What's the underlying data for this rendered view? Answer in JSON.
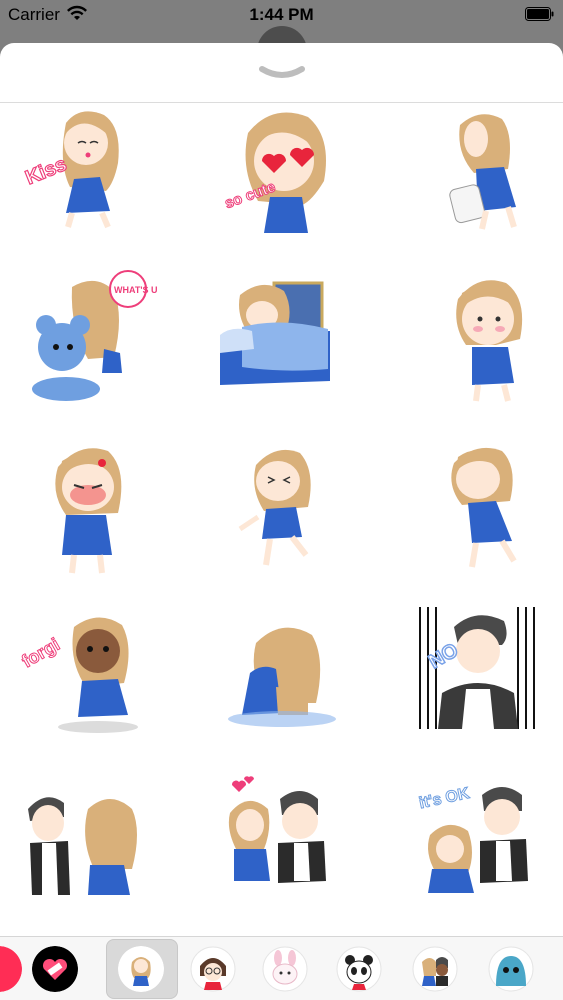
{
  "status_bar": {
    "carrier": "Carrier",
    "time": "1:44 PM"
  },
  "sheet": {
    "collapse_icon": "chevron-down-icon"
  },
  "stickers": [
    {
      "name": "sticker-kiss",
      "caption": "Kiss",
      "colors": {
        "hair": "#d9b07a",
        "dress": "#2f62c8",
        "text": "#ee3e7a"
      }
    },
    {
      "name": "sticker-so-cute",
      "caption": "so cute",
      "colors": {
        "hair": "#d9b07a",
        "dress": "#2f62c8",
        "text": "#ee3e7a"
      }
    },
    {
      "name": "sticker-pillow",
      "caption": "",
      "colors": {
        "hair": "#d9b07a",
        "dress": "#2f62c8"
      }
    },
    {
      "name": "sticker-whats-up",
      "caption": "WHAT'S UP",
      "colors": {
        "bear": "#6f9fe0",
        "text": "#ee3e7a"
      }
    },
    {
      "name": "sticker-bed",
      "caption": "",
      "colors": {
        "bed": "#2f62c8",
        "blanket": "#8eb5ec"
      }
    },
    {
      "name": "sticker-shy",
      "caption": "",
      "colors": {
        "hair": "#d9b07a",
        "dress": "#2f62c8"
      }
    },
    {
      "name": "sticker-angry",
      "caption": "",
      "colors": {
        "hair": "#d9b07a",
        "dress": "#2f62c8",
        "face": "#f07070"
      }
    },
    {
      "name": "sticker-cry-run",
      "caption": "",
      "colors": {
        "hair": "#d9b07a",
        "dress": "#2f62c8"
      }
    },
    {
      "name": "sticker-walk-away",
      "caption": "",
      "colors": {
        "hair": "#d9b07a",
        "dress": "#2f62c8"
      }
    },
    {
      "name": "sticker-forgive",
      "caption": "forgi",
      "colors": {
        "hair": "#d9b07a",
        "dress": "#2f62c8",
        "text": "#ee3e7a"
      }
    },
    {
      "name": "sticker-sad-sit",
      "caption": "",
      "colors": {
        "hair": "#d9b07a",
        "dress": "#2f62c8"
      }
    },
    {
      "name": "sticker-no",
      "caption": "NO",
      "colors": {
        "hair": "#4a4a4a",
        "shirt": "#3a3a3a",
        "text": "#7aa2e8"
      }
    },
    {
      "name": "sticker-couple-whisper",
      "caption": "",
      "colors": {
        "boy": "#2b2b2b",
        "girl": "#2f62c8"
      }
    },
    {
      "name": "sticker-couple-hearts",
      "caption": "",
      "colors": {
        "boy": "#2b2b2b",
        "girl": "#2f62c8",
        "hearts": "#ee3e7a"
      }
    },
    {
      "name": "sticker-its-ok",
      "caption": "it's OK",
      "colors": {
        "boy": "#2b2b2b",
        "girl": "#2f62c8",
        "text": "#6f9fe0"
      }
    }
  ],
  "app_drawer": {
    "apps": [
      {
        "name": "app-icon-red-partial",
        "icon": "red-app-icon",
        "color": "#ff2d55"
      },
      {
        "name": "app-icon-heart-bandage",
        "icon": "heart-bandage-icon",
        "color": "#000000"
      },
      {
        "name": "app-icon-girl-sticker-pack",
        "icon": "girl-sticker-icon",
        "color": "#d9b07a",
        "selected": true
      },
      {
        "name": "app-icon-glasses-girl",
        "icon": "glasses-girl-icon",
        "color": "#5a3a2a"
      },
      {
        "name": "app-icon-bunny",
        "icon": "bunny-icon",
        "color": "#f5c6d6"
      },
      {
        "name": "app-icon-panda",
        "icon": "panda-icon",
        "color": "#222222"
      },
      {
        "name": "app-icon-couple",
        "icon": "couple-icon",
        "color": "#d9b07a"
      },
      {
        "name": "app-icon-blue-monster",
        "icon": "blue-monster-icon",
        "color": "#4aa7c8"
      }
    ]
  }
}
